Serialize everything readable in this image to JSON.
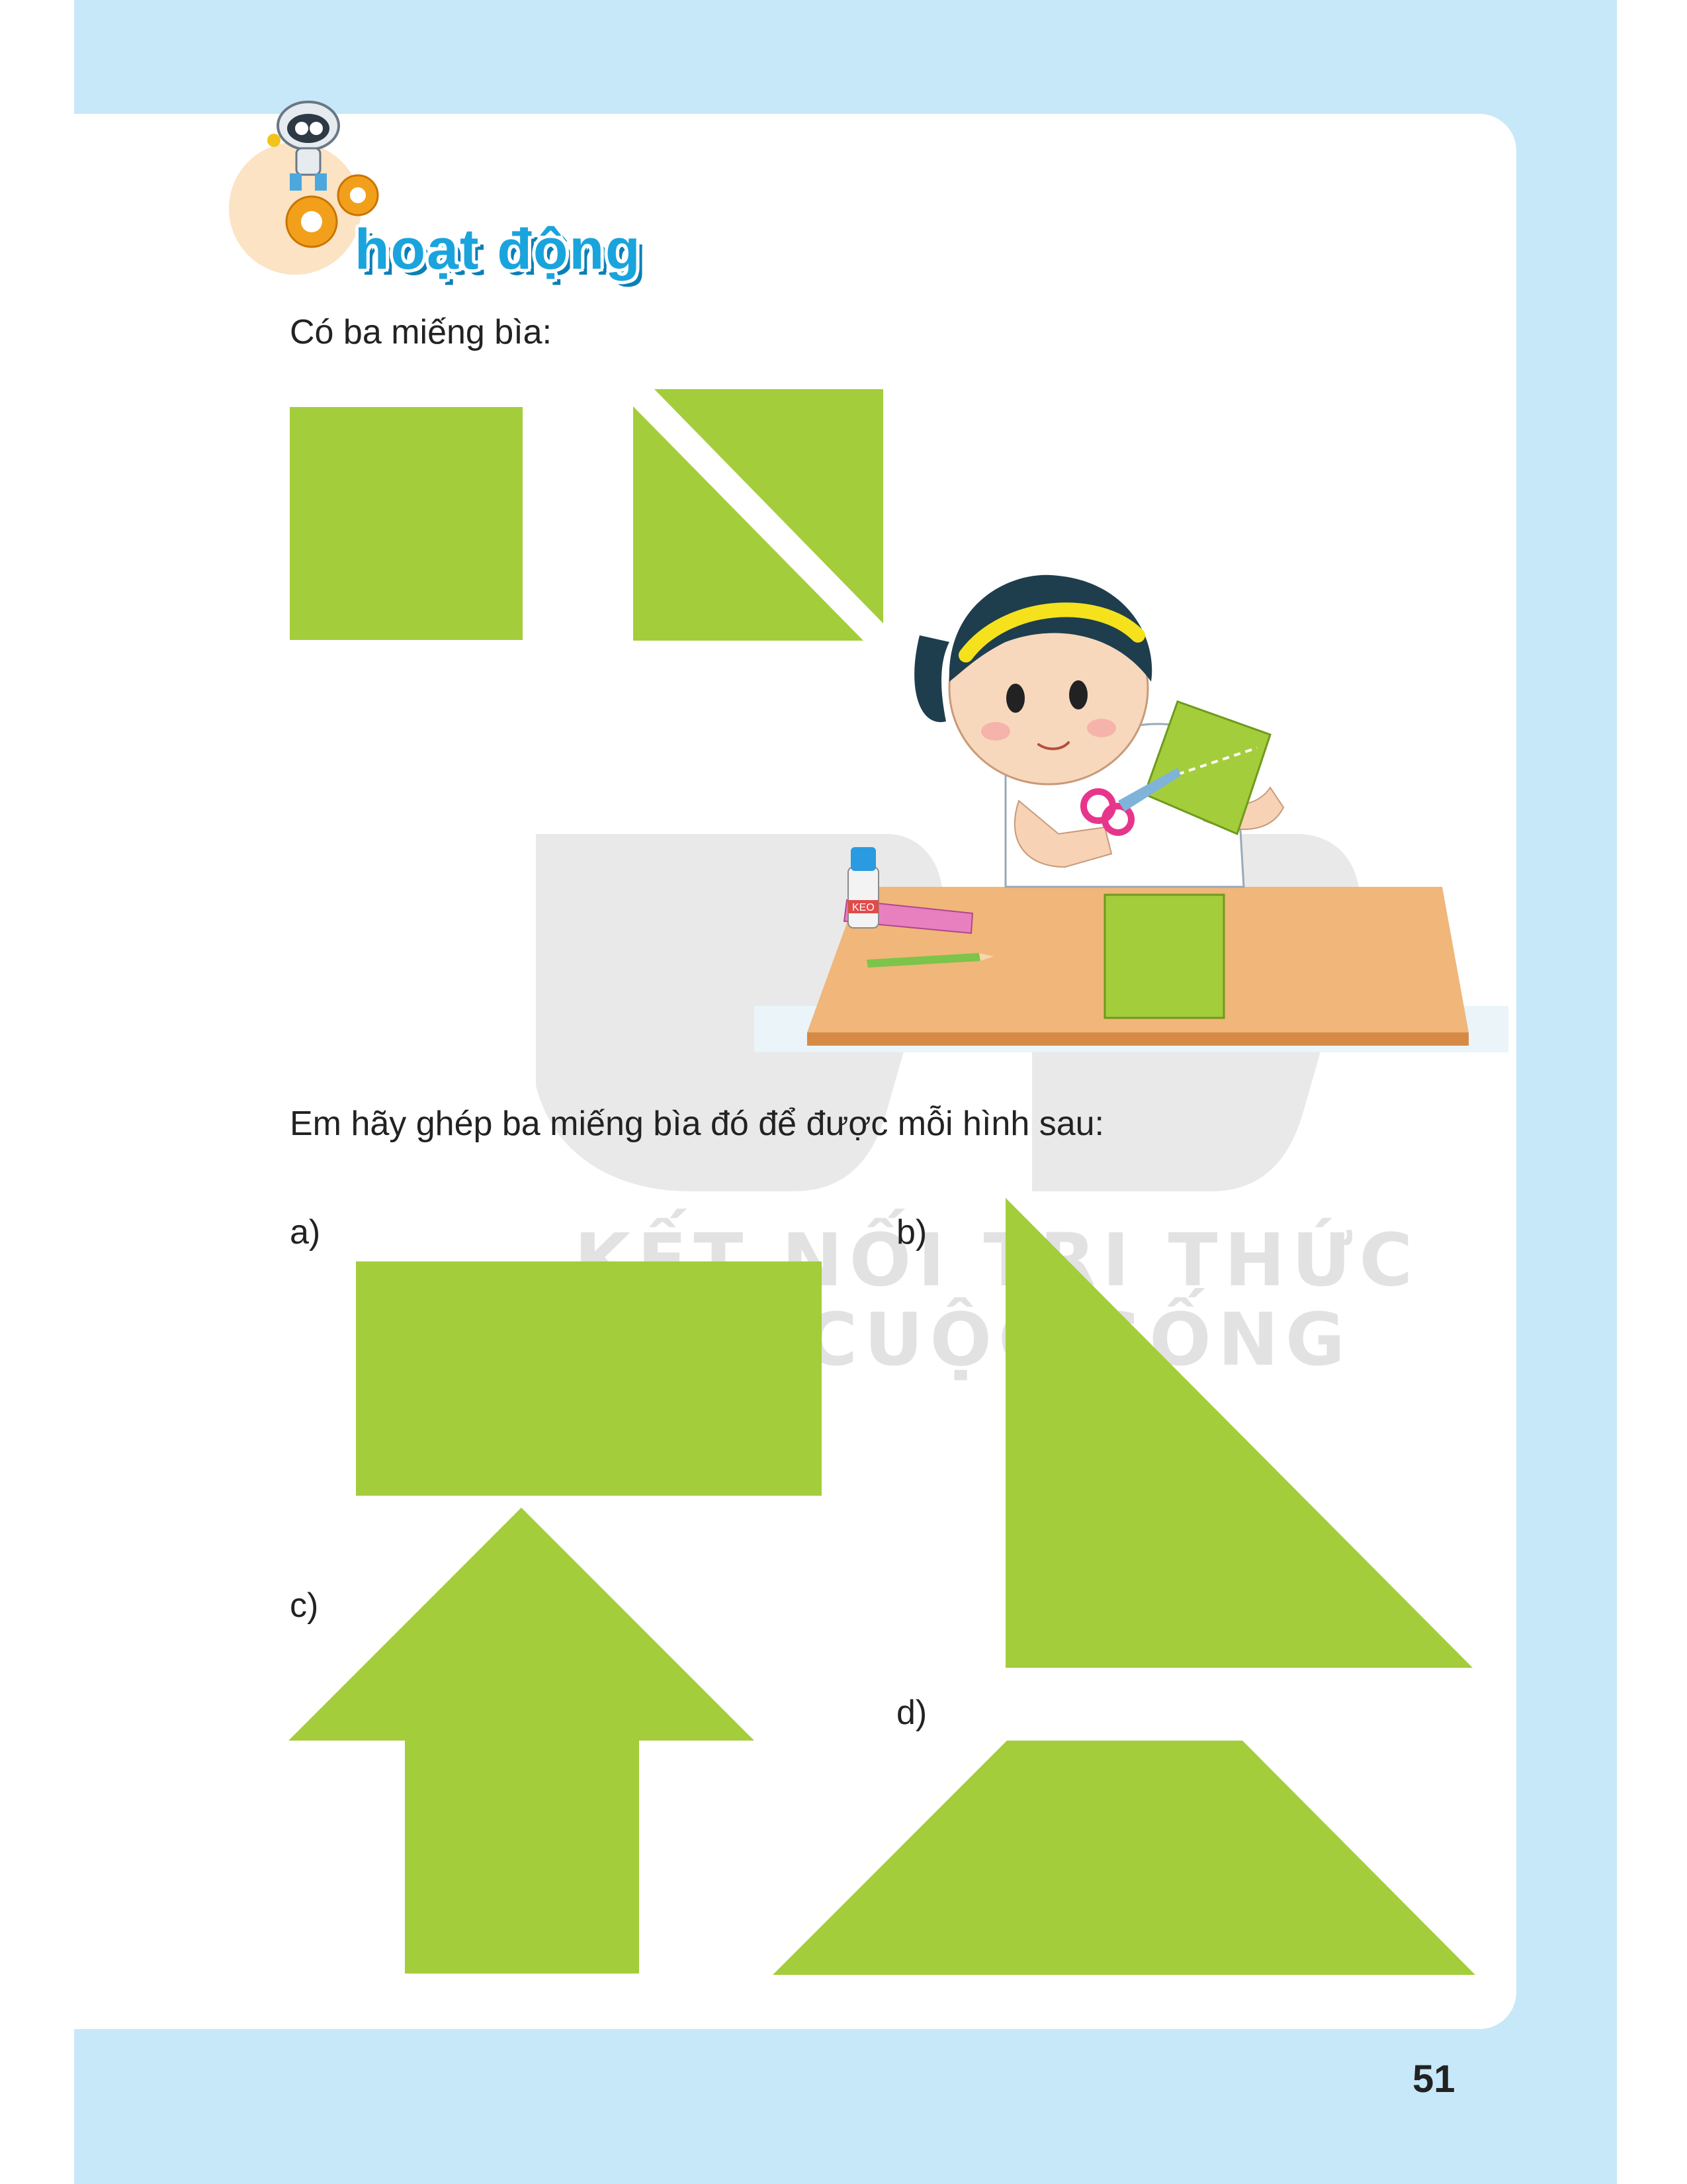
{
  "header": {
    "section_title": "hoạt động"
  },
  "intro": {
    "text": "Có ba miếng bìa:"
  },
  "instruction": {
    "text": "Em hãy ghép ba miếng bìa đó để được mỗi hình sau:"
  },
  "figures": {
    "a_label": "a)",
    "b_label": "b)",
    "c_label": "c)",
    "d_label": "d)"
  },
  "illustration": {
    "glue_label": "KEO"
  },
  "watermark": {
    "line1": "KẾT NỐI TRI THỨC",
    "line2": "VỚI CUỘC SỐNG"
  },
  "footer": {
    "page_number": "51"
  },
  "colors": {
    "frame": "#c7e8f8",
    "shape_green": "#a4cd3c",
    "title_blue": "#1aa4dd"
  }
}
